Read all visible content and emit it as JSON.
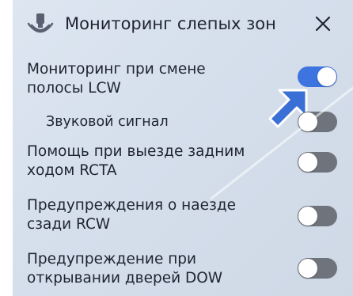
{
  "header": {
    "title": "Мониторинг слепых зон",
    "icon": "blind-spot-sensor-icon",
    "close_icon": "close-icon"
  },
  "settings": [
    {
      "lines": [
        "Мониторинг при смене",
        "полосы LCW"
      ],
      "enabled": true
    },
    {
      "lines": [
        "Звуковой сигнал"
      ],
      "enabled": false
    },
    {
      "lines": [
        "Помощь при выезде задним",
        "ходом RCTA"
      ],
      "enabled": false
    },
    {
      "lines": [
        "Предупреждения о наезде",
        "сзади RCW"
      ],
      "enabled": false
    },
    {
      "lines": [
        "Предупреждение при",
        "открывании дверей DOW"
      ],
      "enabled": false
    }
  ],
  "colors": {
    "panel_background": "#d7e1ee",
    "toggle_on": "#3d74e0",
    "toggle_off": "#6f747c",
    "pointer_arrow": "#3a6fd6"
  }
}
